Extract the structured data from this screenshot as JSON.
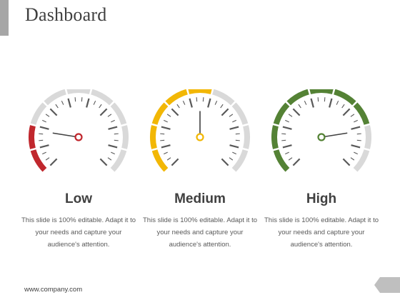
{
  "slide": {
    "title": "Dashboard",
    "footer_url": "www.company.com"
  },
  "gauges": [
    {
      "label": "Low",
      "description": "This slide is 100% editable. Adapt it to your needs and capture your audience's attention.",
      "color": "#c0272d",
      "level": 0.2
    },
    {
      "label": "Medium",
      "description": "This slide is 100% editable. Adapt it to your needs and capture your audience's attention.",
      "color": "#f2b705",
      "level": 0.5
    },
    {
      "label": "High",
      "description": "This slide is 100% editable. Adapt it to your needs and capture your audience's attention.",
      "color": "#548235",
      "level": 0.8
    }
  ],
  "colors": {
    "track": "#d9d9d9",
    "tick": "#595959"
  }
}
